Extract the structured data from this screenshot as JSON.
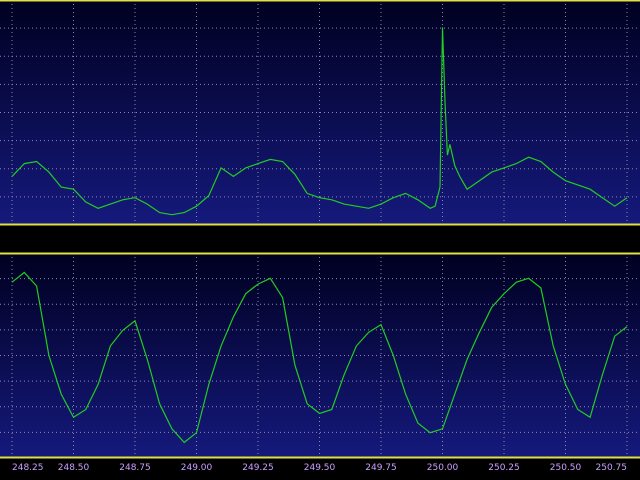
{
  "chart_data": [
    {
      "type": "line",
      "panel": "top",
      "title": "",
      "grid": true,
      "x_range": [
        248.25,
        250.75
      ],
      "y_range": [
        0,
        1
      ],
      "line_color": "#22cc22",
      "x": [
        248.25,
        248.3,
        248.35,
        248.4,
        248.45,
        248.5,
        248.55,
        248.6,
        248.65,
        248.7,
        248.75,
        248.8,
        248.85,
        248.9,
        248.95,
        249.0,
        249.05,
        249.1,
        249.15,
        249.2,
        249.25,
        249.3,
        249.35,
        249.4,
        249.45,
        249.5,
        249.55,
        249.6,
        249.65,
        249.7,
        249.75,
        249.8,
        249.85,
        249.9,
        249.95,
        249.97,
        249.99,
        250.0,
        250.01,
        250.02,
        250.03,
        250.05,
        250.07,
        250.1,
        250.15,
        250.2,
        250.25,
        250.3,
        250.35,
        250.4,
        250.45,
        250.5,
        250.55,
        250.6,
        250.65,
        250.7,
        250.75
      ],
      "y": [
        0.2,
        0.26,
        0.27,
        0.22,
        0.15,
        0.14,
        0.08,
        0.05,
        0.07,
        0.09,
        0.1,
        0.07,
        0.03,
        0.02,
        0.03,
        0.06,
        0.11,
        0.24,
        0.2,
        0.24,
        0.26,
        0.28,
        0.27,
        0.21,
        0.12,
        0.1,
        0.09,
        0.07,
        0.06,
        0.05,
        0.07,
        0.1,
        0.12,
        0.09,
        0.05,
        0.06,
        0.15,
        0.9,
        0.55,
        0.3,
        0.35,
        0.25,
        0.2,
        0.14,
        0.18,
        0.22,
        0.24,
        0.26,
        0.29,
        0.27,
        0.22,
        0.18,
        0.16,
        0.14,
        0.1,
        0.06,
        0.1
      ]
    },
    {
      "type": "line",
      "panel": "bottom",
      "title": "",
      "grid": true,
      "x_range": [
        248.25,
        250.75
      ],
      "y_range": [
        0,
        1
      ],
      "line_color": "#22cc22",
      "x": [
        248.25,
        248.3,
        248.35,
        248.4,
        248.45,
        248.5,
        248.55,
        248.6,
        248.65,
        248.7,
        248.75,
        248.8,
        248.85,
        248.9,
        248.95,
        249.0,
        249.05,
        249.1,
        249.15,
        249.2,
        249.25,
        249.3,
        249.35,
        249.4,
        249.45,
        249.5,
        249.55,
        249.6,
        249.65,
        249.7,
        249.75,
        249.8,
        249.85,
        249.9,
        249.95,
        250.0,
        250.05,
        250.1,
        250.15,
        250.2,
        250.25,
        250.3,
        250.35,
        250.4,
        250.45,
        250.5,
        250.55,
        250.6,
        250.65,
        250.7,
        250.75
      ],
      "y": [
        0.88,
        0.93,
        0.86,
        0.5,
        0.3,
        0.18,
        0.22,
        0.35,
        0.55,
        0.63,
        0.68,
        0.48,
        0.25,
        0.12,
        0.05,
        0.1,
        0.35,
        0.55,
        0.7,
        0.82,
        0.87,
        0.9,
        0.8,
        0.45,
        0.25,
        0.2,
        0.22,
        0.4,
        0.55,
        0.62,
        0.66,
        0.5,
        0.3,
        0.15,
        0.1,
        0.12,
        0.3,
        0.48,
        0.62,
        0.75,
        0.82,
        0.88,
        0.9,
        0.85,
        0.55,
        0.35,
        0.22,
        0.18,
        0.4,
        0.6,
        0.65
      ]
    }
  ],
  "x_tick_labels": [
    "248.25",
    "248.50",
    "248.75",
    "249.00",
    "249.25",
    "249.50",
    "249.75",
    "250.00",
    "250.25",
    "250.50",
    "250.75"
  ],
  "colors": {
    "background": "#000000",
    "panel_gradient_top": "#000022",
    "panel_gradient_bottom": "#14187a",
    "grid": "#8a8ab0",
    "border": "#e0e040",
    "trace": "#22cc22",
    "tick_label": "#c8a0ff"
  }
}
